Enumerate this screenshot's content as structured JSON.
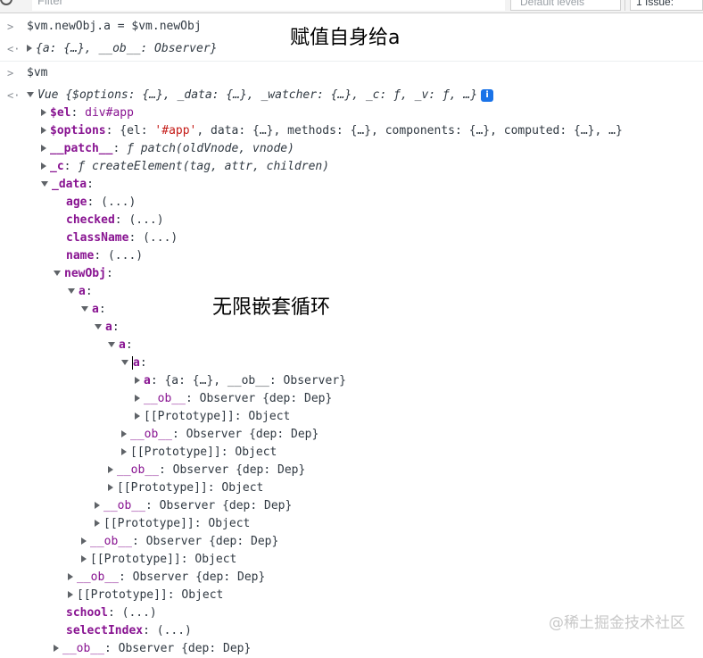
{
  "toolbar": {
    "filter_placeholder": "Filter",
    "levels": "Default levels",
    "issues": "1 Issue:"
  },
  "console": {
    "input1": "$vm.newObj.a = $vm.newObj",
    "output1_preview": "{a: {…}, __ob__: Observer}",
    "input2": "$vm",
    "vue_name": "Vue",
    "vue_preview": "{$options: {…}, _data: {…}, _watcher: {…}, _c: ƒ, _v: ƒ, …}",
    "el_key": "$el",
    "el_val": "div#app",
    "options_key": "$options",
    "options_open": "{el: ",
    "options_el": "'#app'",
    "options_rest": ", data: {…}, methods: {…}, components: {…}, computed: {…}, …}",
    "patch_key": "__patch__",
    "patch_val": "ƒ patch(oldVnode, vnode)",
    "c_key": "_c",
    "c_val": "ƒ createElement(tag, attr, children)",
    "data_key": "_data",
    "getter": "(...)",
    "age_key": "age",
    "checked_key": "checked",
    "classname_key": "className",
    "name_key": "name",
    "newobj_key": "newObj",
    "a_key": "a",
    "deep_a_preview": "{a: {…}, __ob__: Observer}",
    "ob_key": "__ob__",
    "ob_val": "Observer {dep: Dep}",
    "proto_key": "[[Prototype]]",
    "proto_val": "Object",
    "school_key": "school",
    "selectindex_key": "selectIndex",
    "next_ob_val": "Observer {dep: Dep}"
  },
  "annotations": {
    "assign_note": "赋值自身给a",
    "nested_note": "无限嵌套循环"
  },
  "watermark": "@稀土掘金技术社区"
}
